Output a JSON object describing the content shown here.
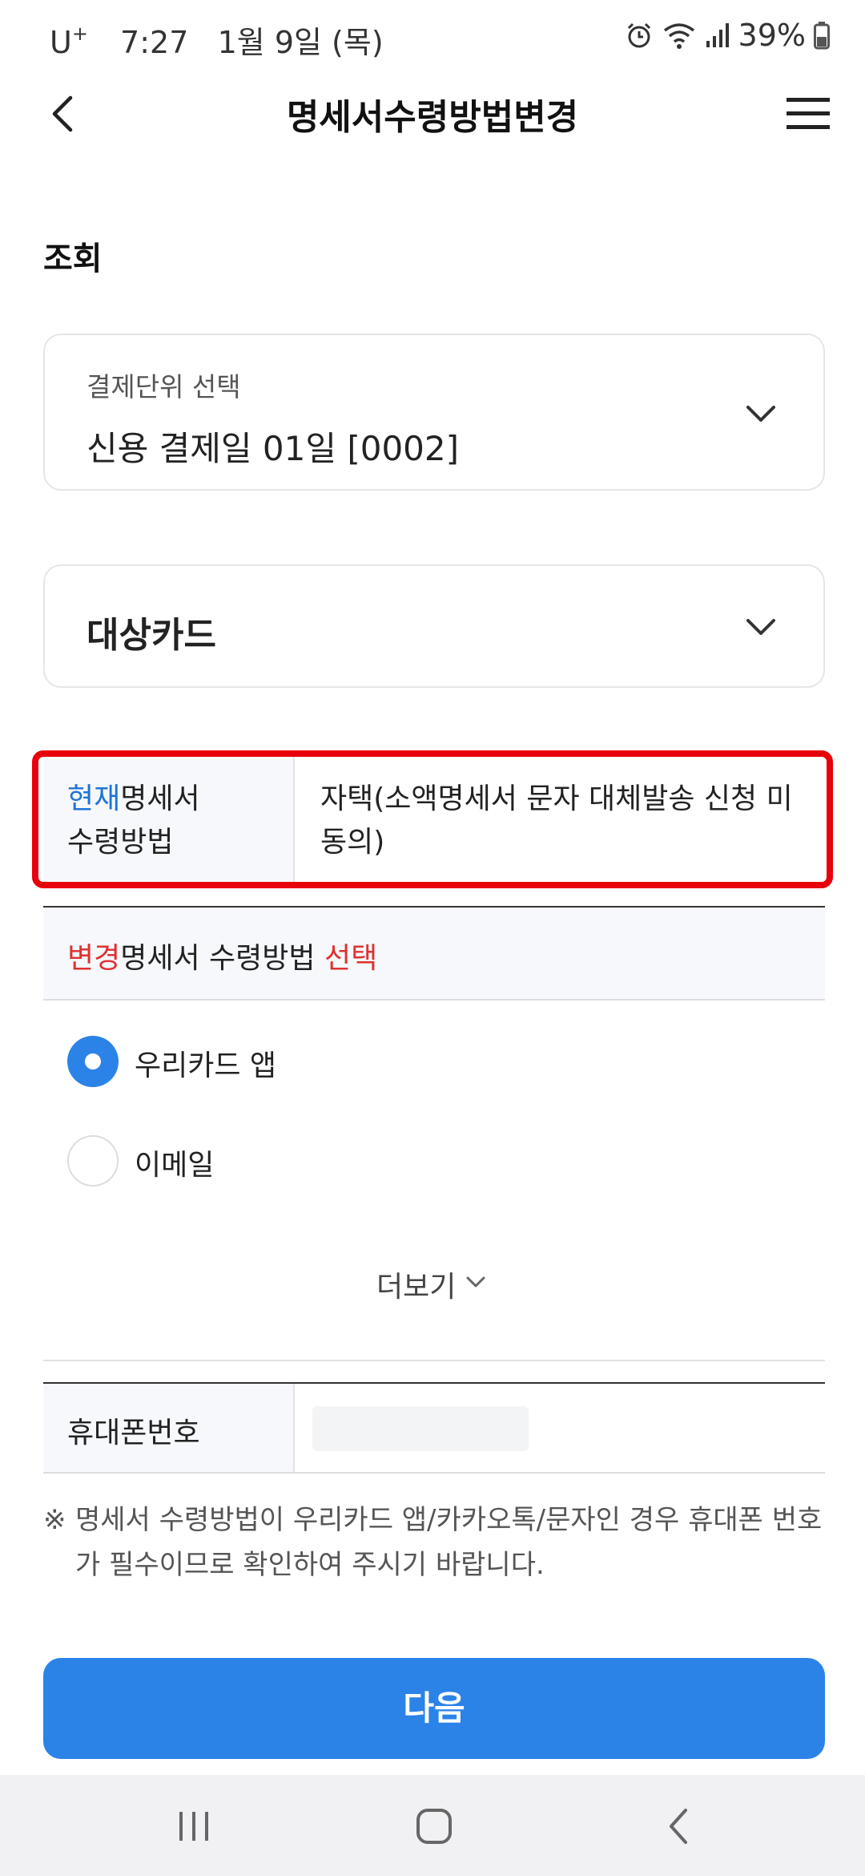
{
  "status_bar": {
    "carrier": "U",
    "carrier_sup": "+",
    "time": "7:27",
    "date": "1월 9일 (목)",
    "battery": "39%",
    "icons": [
      "alarm-icon",
      "wifi-icon",
      "signal-icon",
      "battery-icon"
    ]
  },
  "header": {
    "title": "명세서수령방법변경",
    "back_icon": "chevron-left-icon",
    "menu_icon": "hamburger-menu-icon"
  },
  "section_title": "조회",
  "payment_select": {
    "label": "결제단위 선택",
    "value": "신용 결제일 01일 [0002]"
  },
  "card_select": {
    "value": "대상카드"
  },
  "current_method": {
    "header_highlight": "현재",
    "header_rest": "명세서",
    "header_line2": "수령방법",
    "value": "자택(소액명세서 문자 대체발송 신청 미동의)"
  },
  "change_method": {
    "highlight_prefix": "변경",
    "middle": "명세서 수령방법 ",
    "highlight_suffix": "선택",
    "options": [
      {
        "label": "우리카드 앱",
        "checked": true
      },
      {
        "label": "이메일",
        "checked": false
      }
    ],
    "more_label": "더보기"
  },
  "phone": {
    "label": "휴대폰번호",
    "value": ""
  },
  "notice": {
    "mark": "※",
    "text": "명세서 수령방법이 우리카드 앱/카카오톡/문자인 경우 휴대폰 번호가 필수이므로 확인하여 주시기 바랍니다."
  },
  "next_button": "다음",
  "colors": {
    "primary": "#2b83e8",
    "highlight_blue": "#1f73d8",
    "highlight_red": "#e03131",
    "annotation_frame": "#e8000b"
  }
}
